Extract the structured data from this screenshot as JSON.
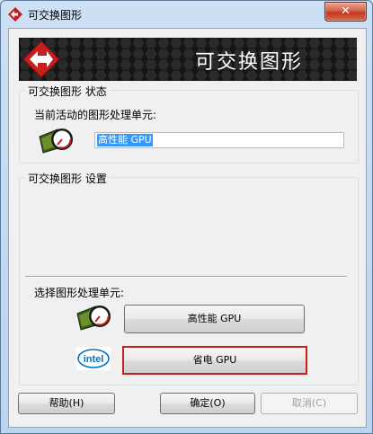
{
  "window": {
    "title": "可交换图形",
    "close_label": "✕"
  },
  "banner": {
    "title": "可交换图形"
  },
  "status_group": {
    "label": "可交换图形 状态",
    "active_gpu_label": "当前活动的图形处理单元:",
    "active_gpu_value": "高性能 GPU"
  },
  "settings_group": {
    "label": "可交换图形 设置",
    "select_gpu_label": "选择图形处理单元:",
    "high_performance_button": "高性能 GPU",
    "power_saving_button": "省电 GPU",
    "intel_logo_text": "intel"
  },
  "footer": {
    "help_button": "帮助(H)",
    "ok_button": "确定(O)",
    "cancel_button": "取消(C)"
  },
  "colors": {
    "selection_border": "#c81e1e",
    "highlight": "#3399ff",
    "banner_bg": "#161616",
    "intel_blue": "#0071c5"
  }
}
